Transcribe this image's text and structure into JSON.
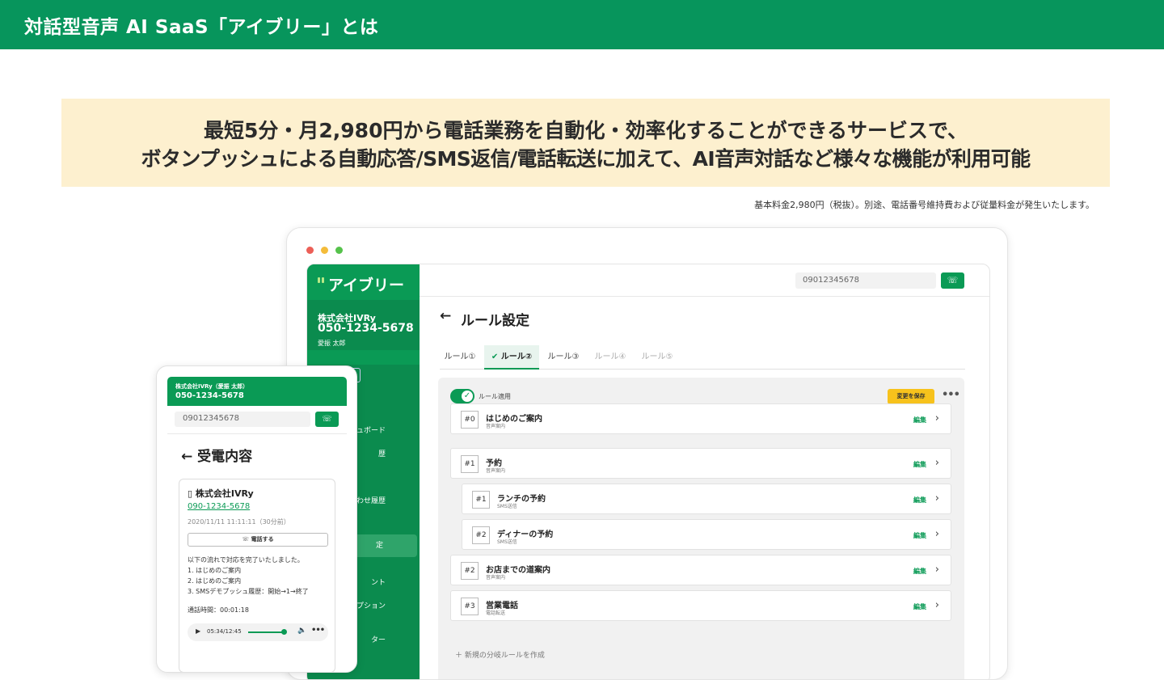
{
  "header": {
    "title": "対話型音声 AI SaaS「アイブリー」とは"
  },
  "banner": {
    "line1": "最短5分・月2,980円から電話業務を自動化・効率化することができるサービスで、",
    "line2": "ボタンプッシュによる自動応答/SMS返信/電話転送に加えて、AI音声対話など様々な機能が利用可能"
  },
  "note": "基本料金2,980円（税抜）。別途、電話番号維持費および従量料金が発生いたします。",
  "colors": {
    "brand": "#07955c",
    "accent_yellow": "#f7c21c",
    "banner_bg": "#fdf0cf"
  },
  "desktop": {
    "logo": "アイブリー",
    "company": "株式会社IVRy",
    "company_phone": "050-1234-5678",
    "user": "愛振 太郎",
    "sidebar_items": [
      "ュボード",
      "歴",
      "",
      "わせ履歴",
      "定",
      "ント",
      "・オプション",
      "ター"
    ],
    "dial_input": "09012345678",
    "call_icon": "phone-icon",
    "page_title": "ルール設定",
    "tabs": [
      "ルール①",
      "ルール②",
      "ルール③",
      "ルール④",
      "ルール⑤"
    ],
    "toggle_label": "ルール適用",
    "save_label": "変更を保存",
    "more_label": "•••",
    "edit_label": "編集",
    "rules": [
      {
        "num": "#0",
        "name": "はじめのご案内",
        "sub": "音声案内"
      },
      {
        "num": "#1",
        "name": "予約",
        "sub": "音声案内"
      },
      {
        "num": "#1",
        "name": "ランチの予約",
        "sub": "SMS送信"
      },
      {
        "num": "#2",
        "name": "ディナーの予約",
        "sub": "SMS送信"
      },
      {
        "num": "#2",
        "name": "お店までの道案内",
        "sub": "音声案内"
      },
      {
        "num": "#3",
        "name": "営業電話",
        "sub": "電話転送"
      }
    ],
    "new_rule": "新規の分岐ルールを作成"
  },
  "phone": {
    "company": "株式会社IVRy（愛振 太郎）",
    "company_phone": "050-1234-5678",
    "dial_input": "09012345678",
    "title": "受電内容",
    "card": {
      "company": "株式会社IVRy",
      "tel": "090-1234-5678",
      "time": "2020/11/11 11:11:11（30分前）",
      "call_btn": "電話する",
      "lines": [
        "以下の流れで対応を完了いたしました。",
        "1. はじめのご案内",
        "2. はじめのご案内",
        "3. SMSデモプッシュ履歴：開始→1→終了"
      ],
      "duration": "通話時間：00:01:18",
      "player_time": "05:34/12:45"
    }
  }
}
